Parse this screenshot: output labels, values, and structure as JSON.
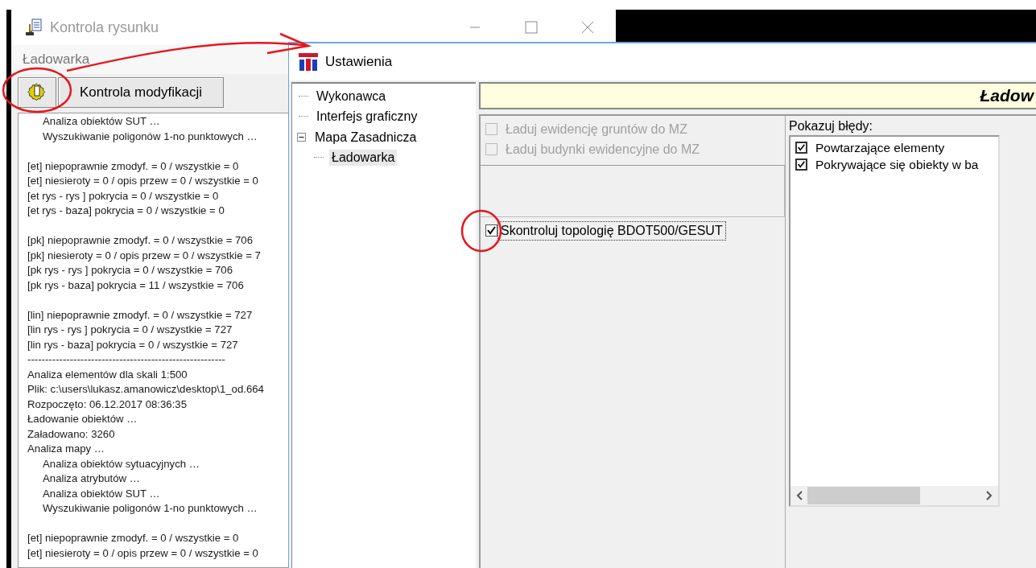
{
  "back_window": {
    "title": "Kontrola rysunku",
    "section_label": "Ładowarka",
    "toolbar": {
      "button": "Kontrola modyfikacji"
    },
    "log_blocks": [
      {
        "lines": [
          {
            "children": [
              {
                "text": "Analiza obiektów SUT …"
              },
              {
                "text": "Wyszukiwanie poligonów 1-no punktowych …"
              }
            ]
          }
        ]
      },
      {
        "lines": [
          {
            "text": "[et] niepoprawnie zmodyf. = 0 / wszystkie = 0"
          },
          {
            "text": "[et] niesieroty = 0 / opis przew = 0 / wszystkie = 0"
          },
          {
            "text": "[et rys - rys ] pokrycia = 0 / wszystkie = 0"
          },
          {
            "text": "[et rys - baza] pokrycia = 0 / wszystkie = 0"
          }
        ]
      },
      {
        "lines": [
          {
            "text": "[pk] niepoprawnie zmodyf. = 0 / wszystkie = 706"
          },
          {
            "text": "[pk] niesieroty = 0 / opis przew = 0 / wszystkie = 7"
          },
          {
            "text": "[pk rys - rys ] pokrycia = 0 / wszystkie = 706"
          },
          {
            "text": "[pk rys - baza] pokrycia = 11 / wszystkie = 706"
          }
        ]
      },
      {
        "lines": [
          {
            "text": "[lin] niepoprawnie zmodyf. = 0 / wszystkie = 727"
          },
          {
            "text": "[lin rys - rys ] pokrycia = 0 / wszystkie = 727"
          },
          {
            "text": "[lin rys - baza] pokrycia = 0 / wszystkie = 727"
          },
          {
            "text": "--------------------------------------------------------"
          },
          {
            "text": "Analiza elementów dla skali 1:500"
          },
          {
            "text": "Plik: c:\\users\\lukasz.amanowicz\\desktop\\1_od.664"
          },
          {
            "text": "Rozpoczęto: 06.12.2017 08:36:35"
          },
          {
            "text": "Ładowanie obiektów …"
          },
          {
            "text": "Załadowano: 3260"
          },
          {
            "text": "Analiza mapy …",
            "children": [
              {
                "text": "Analiza obiektów sytuacyjnych …"
              },
              {
                "text": "Analiza atrybutów …"
              },
              {
                "text": "Analiza obiektów SUT …"
              },
              {
                "text": "Wyszukiwanie poligonów 1-no punktowych …"
              }
            ]
          }
        ]
      },
      {
        "lines": [
          {
            "text": "[et] niepoprawnie zmodyf. = 0 / wszystkie = 0"
          },
          {
            "text": "[et] niesieroty = 0 / opis przew = 0 / wszystkie = 0"
          }
        ]
      }
    ]
  },
  "dialog": {
    "title": "Ustawienia",
    "tree": [
      {
        "label": "Wykonawca",
        "selected": false
      },
      {
        "label": "Interfejs graficzny",
        "selected": false
      },
      {
        "label": "Mapa Zasadnicza",
        "selected": false,
        "expanded": true,
        "children": [
          {
            "label": "Ładowarka",
            "selected": true
          }
        ]
      }
    ],
    "header": "Ładow",
    "load_options": [
      {
        "label": "Ładuj ewidencję gruntów do MZ",
        "checked": false,
        "disabled": true
      },
      {
        "label": "Ładuj budynki ewidencyjne do MZ",
        "checked": false,
        "disabled": true
      }
    ],
    "topology_option": {
      "label": "Skontroluj topologię BDOT500/GESUT",
      "checked": true,
      "focused": true
    },
    "errors": {
      "label": "Pokazuj błędy:",
      "items": [
        {
          "label": "Powtarzające elementy",
          "checked": true
        },
        {
          "label": "Pokrywające się obiekty w ba",
          "checked": true
        }
      ]
    }
  },
  "annotations": [
    {
      "kind": "arrow"
    },
    {
      "kind": "circle"
    },
    {
      "kind": "circle"
    }
  ]
}
